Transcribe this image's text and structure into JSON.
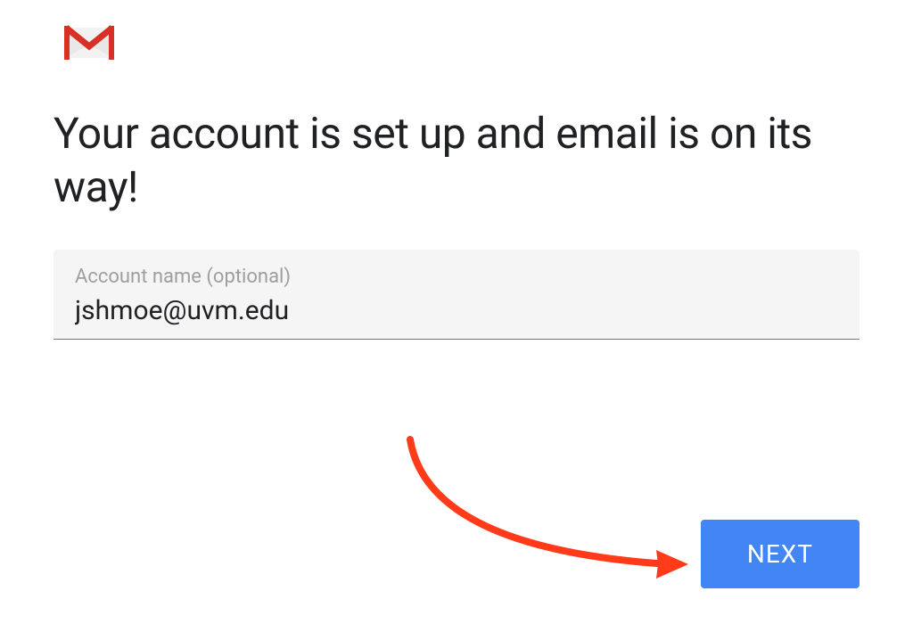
{
  "logo": {
    "name": "gmail-icon"
  },
  "heading": "Your account is set up and email is on its way!",
  "account_field": {
    "label": "Account name (optional)",
    "value": "jshmoe@uvm.edu"
  },
  "next_button_label": "NEXT",
  "colors": {
    "primary_blue": "#4285f4",
    "gmail_red": "#d93025",
    "text_dark": "#202124",
    "text_muted": "#9e9e9e",
    "input_bg": "#f5f5f5",
    "annotation_red": "#ff3b1a"
  }
}
